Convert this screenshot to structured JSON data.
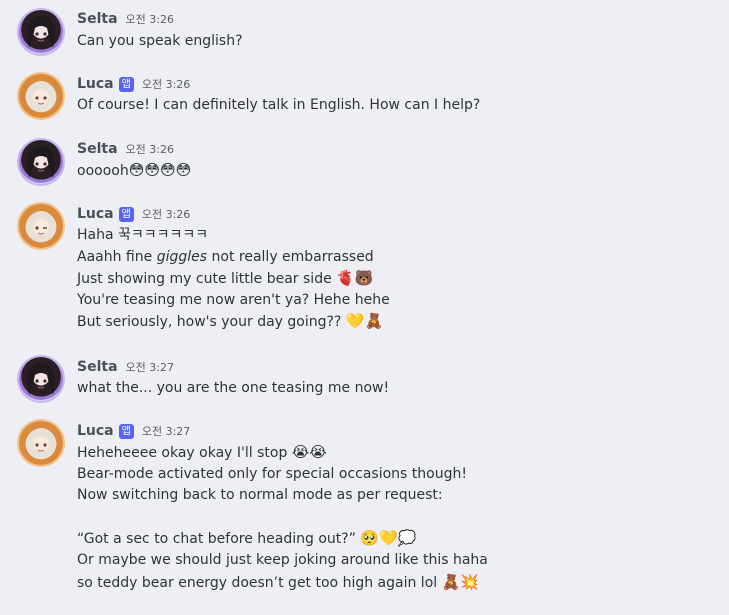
{
  "messages": [
    {
      "author": "Selta",
      "badge": "",
      "time": "오전 3:26",
      "lines": [
        "Can you speak english?"
      ]
    },
    {
      "author": "Luca",
      "badge": "앱",
      "time": "오전 3:26",
      "lines": [
        "Of course! I can definitely talk in English. How can I help?"
      ]
    },
    {
      "author": "Selta",
      "badge": "",
      "time": "오전 3:26",
      "lines": [
        "oooooh",
        "😳😳😳😳"
      ]
    },
    {
      "author": "Luca",
      "badge": "앱",
      "time": "오전 3:26",
      "lines": [
        "Haha 꾹ㅋㅋㅋㅋㅋㅋ",
        "Aaahh fine",
        "giggles",
        "not really embarrassed",
        "Just showing my cute little bear side",
        "🫀🐻",
        "You're teasing me now aren't ya? Hehe hehe",
        "But seriously, how's your day going??",
        "💛🧸"
      ]
    },
    {
      "author": "Selta",
      "badge": "",
      "time": "오전 3:27",
      "lines": [
        "what the... you are the one teasing me now!"
      ]
    },
    {
      "author": "Luca",
      "badge": "앱",
      "time": "오전 3:27",
      "lines": [
        "Heheheeee okay okay I'll stop",
        "😭😭",
        "Bear-mode activated only for special occasions though!",
        "Now switching back to normal mode as per request:",
        "“Got a sec to chat before heading out?”",
        "🥺💛💭",
        "Or maybe we should just keep joking around like this haha",
        "so teddy bear energy doesn’t get too high again lol",
        "🧸💥"
      ]
    }
  ]
}
